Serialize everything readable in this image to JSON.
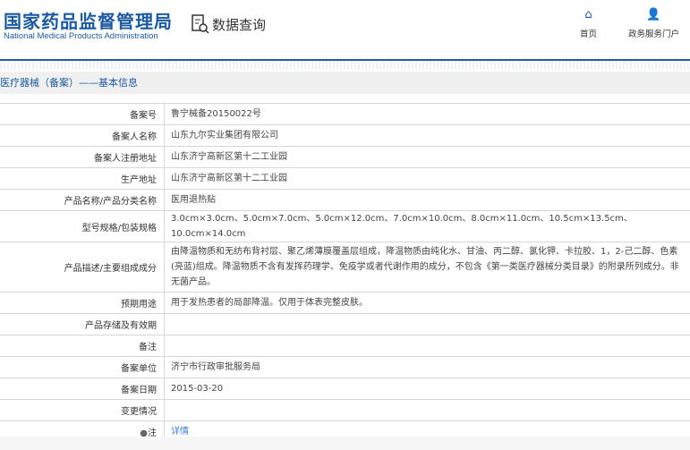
{
  "header": {
    "logo_cn": "国家药品监督管理局",
    "logo_en": "National Medical Products Administration",
    "section": "数据查询",
    "nav": [
      {
        "label": "首页",
        "icon": "home-icon"
      },
      {
        "label": "政务服务门户",
        "icon": "user-icon"
      }
    ]
  },
  "breadcrumb": "医疗器械（备案）——基本信息",
  "rows": [
    {
      "label": "备案号",
      "value": "鲁宁械备20150022号"
    },
    {
      "label": "备案人名称",
      "value": "山东九尔实业集团有限公司"
    },
    {
      "label": "备案人注册地址",
      "value": "山东济宁高新区第十二工业园"
    },
    {
      "label": "生产地址",
      "value": "山东济宁高新区第十二工业园"
    },
    {
      "label": "产品名称/产品分类名称",
      "value": "医用退热贴"
    },
    {
      "label": "型号规格/包装规格",
      "value": "3.0cm×3.0cm、5.0cm×7.0cm、5.0cm×12.0cm、7.0cm×10.0cm、8.0cm×11.0cm、10.5cm×13.5cm、10.0cm×14.0cm"
    },
    {
      "label": "产品描述/主要组成成分",
      "value": "由降温物质和无纺布背衬层、聚乙烯薄膜覆盖层组成，降温物质由纯化水、甘油、丙二醇、氯化钾、卡拉胶、1，2-己二醇、色素(亮蓝)组成。降温物质不含有发挥药理学、免疫学或者代谢作用的成分，不包含《第一类医疗器械分类目录》的附录所列成分。非无菌产品。"
    },
    {
      "label": "预期用途",
      "value": "用于发热患者的局部降温。仅用于体表完整皮肤。"
    },
    {
      "label": "产品存储及有效期",
      "value": ""
    },
    {
      "label": "备注",
      "value": ""
    },
    {
      "label": "备案单位",
      "value": "济宁市行政审批服务局"
    },
    {
      "label": "备案日期",
      "value": "2015-03-20"
    },
    {
      "label": "变更情况",
      "value": ""
    }
  ],
  "note": {
    "label": "注",
    "link": "详情"
  }
}
